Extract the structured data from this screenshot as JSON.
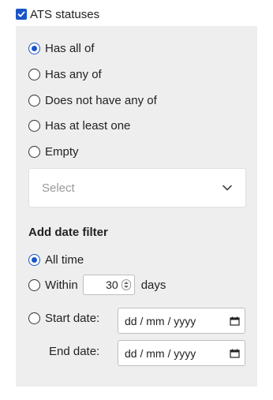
{
  "header": {
    "label": "ATS statuses",
    "checked": true
  },
  "match_options": [
    {
      "label": "Has all of",
      "selected": true
    },
    {
      "label": "Has any of",
      "selected": false
    },
    {
      "label": "Does not have any of",
      "selected": false
    },
    {
      "label": "Has at least one",
      "selected": false
    },
    {
      "label": "Empty",
      "selected": false
    }
  ],
  "select": {
    "placeholder": "Select",
    "icon": "chevron-down-icon"
  },
  "date_filter": {
    "title": "Add date filter",
    "all_time_label": "All time",
    "within_label": "Within",
    "within_value": "30",
    "days_label": "days",
    "start_label": "Start date:",
    "start_placeholder": "dd / mm / yyyy",
    "end_label": "End date:",
    "end_placeholder": "dd / mm / yyyy",
    "calendar_icon": "calendar-icon",
    "selected": "all_time"
  },
  "colors": {
    "accent": "#1a56c8",
    "panel": "#eeeeee",
    "placeholder": "#9a9a9a"
  }
}
